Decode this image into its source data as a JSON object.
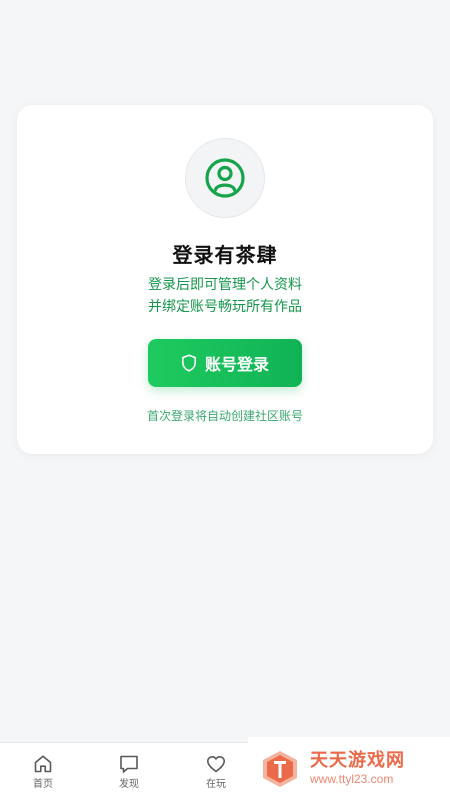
{
  "card": {
    "title": "登录有茶肆",
    "subtitle_line1": "登录后即可管理个人资料",
    "subtitle_line2": "并绑定账号畅玩所有作品",
    "login_button_label": "账号登录",
    "hint": "首次登录将自动创建社区账号",
    "avatar_icon": "user-circle-icon",
    "button_icon": "shield-icon"
  },
  "tabbar": {
    "items": [
      {
        "label": "首页",
        "icon": "home-icon"
      },
      {
        "label": "发现",
        "icon": "message-icon"
      },
      {
        "label": "在玩",
        "icon": "heart-icon"
      }
    ]
  },
  "watermark": {
    "title": "天天游戏网",
    "subtitle": "www.ttyl23.com"
  },
  "colors": {
    "accent": "#10b255",
    "accent_light": "#1ecb5f",
    "background": "#f5f6f8",
    "watermark": "#ea6a49"
  }
}
